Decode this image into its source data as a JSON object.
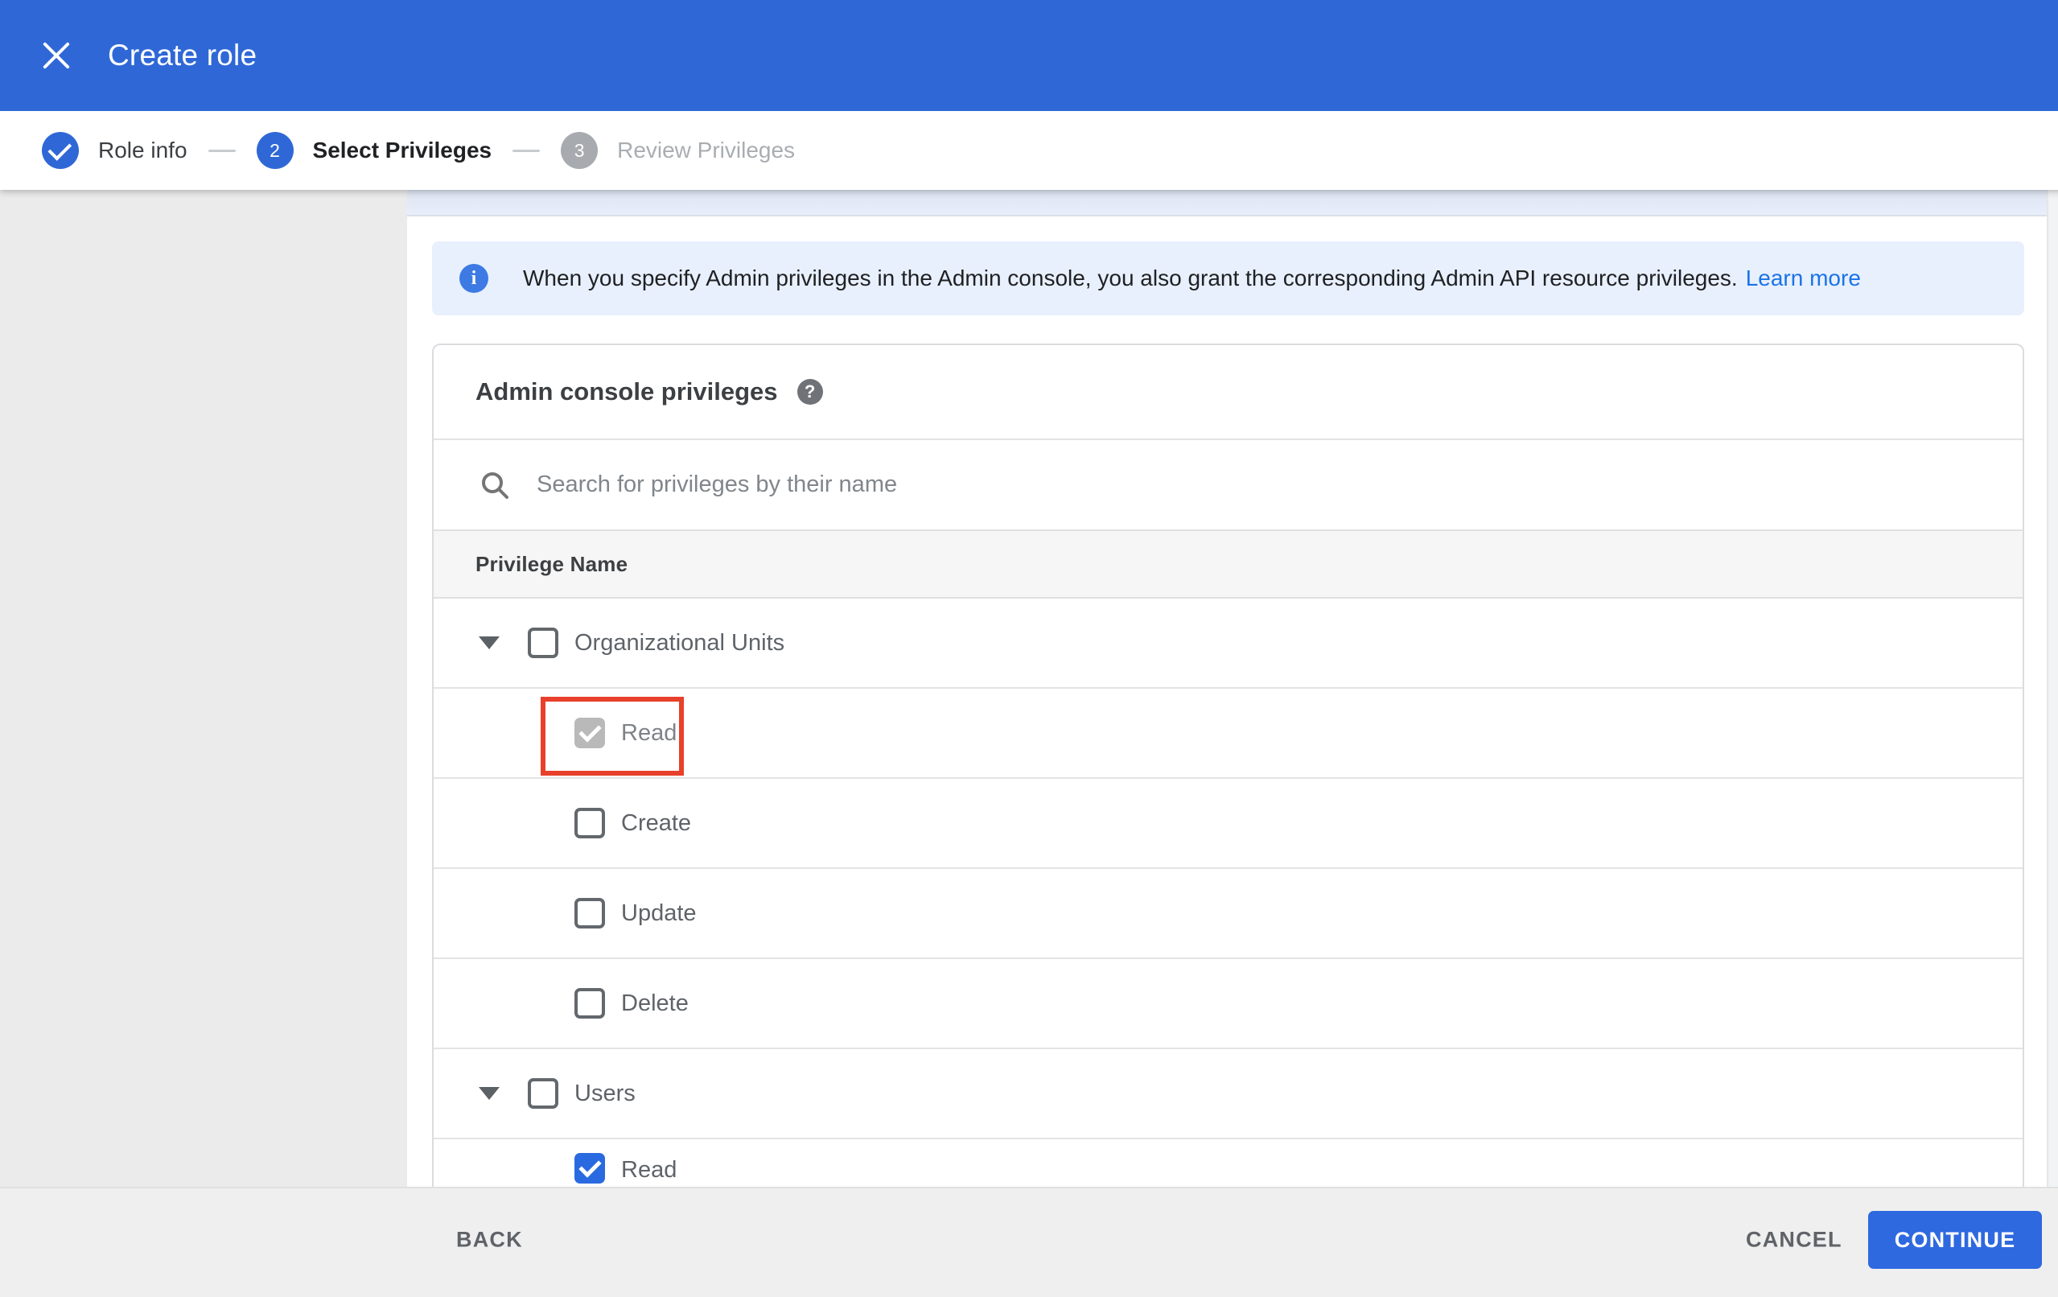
{
  "header": {
    "title": "Create role"
  },
  "stepper": {
    "steps": [
      {
        "number": "",
        "label": "Role info",
        "state": "complete"
      },
      {
        "number": "2",
        "label": "Select Privileges",
        "state": "active"
      },
      {
        "number": "3",
        "label": "Review Privileges",
        "state": "upcoming"
      }
    ]
  },
  "banner": {
    "text": "When you specify Admin privileges in the Admin console, you also grant the corresponding Admin API resource privileges.",
    "link_label": "Learn more"
  },
  "card": {
    "title": "Admin console privileges",
    "search_placeholder": "Search for privileges by their name",
    "search_value": "",
    "column_header": "Privilege Name",
    "rows": [
      {
        "label": "Organizational Units",
        "level": 0,
        "expanded": true,
        "checked": false
      },
      {
        "label": "Read",
        "level": 1,
        "checked": true,
        "checked_style": "gray",
        "highlighted": true
      },
      {
        "label": "Create",
        "level": 1,
        "checked": false
      },
      {
        "label": "Update",
        "level": 1,
        "checked": false
      },
      {
        "label": "Delete",
        "level": 1,
        "checked": false
      },
      {
        "label": "Users",
        "level": 0,
        "expanded": true,
        "checked": false
      },
      {
        "label": "Read",
        "level": 1,
        "checked": true,
        "checked_style": "blue"
      }
    ]
  },
  "footer": {
    "back_label": "BACK",
    "cancel_label": "CANCEL",
    "continue_label": "CONTINUE"
  },
  "colors": {
    "appbar_blue": "#2f68d6",
    "continue_blue": "#2f69e0",
    "link_blue": "#1a73e8",
    "info_icon_blue": "#3d7ae4",
    "banner_bg": "#e8f0fd",
    "checkbox_checked_blue": "#2a6ae0",
    "checkbox_checked_gray": "#b9b9b9",
    "highlight_red": "#e8402a",
    "sidebar_gray": "#ebebeb",
    "footer_gray": "#efefef"
  }
}
